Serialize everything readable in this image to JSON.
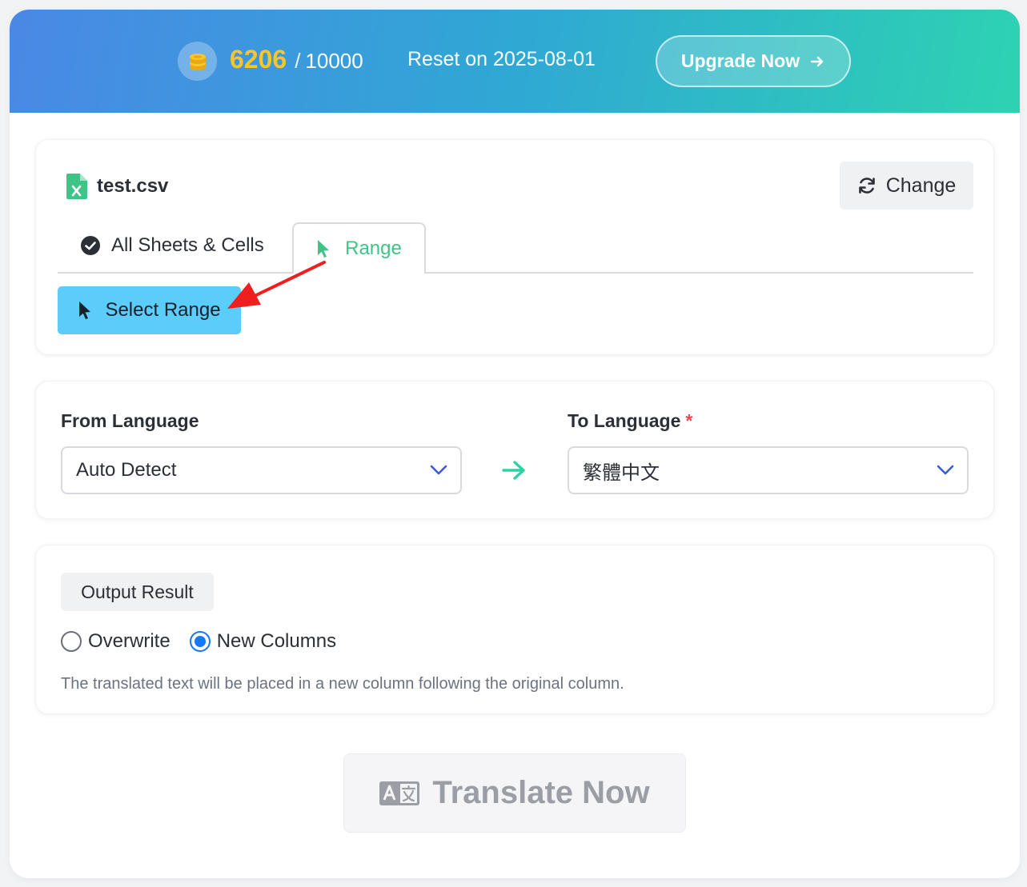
{
  "header": {
    "credits_used": "6206",
    "credits_separator": "/",
    "credits_total": "10000",
    "reset_text": "Reset on 2025-08-01",
    "upgrade_label": "Upgrade Now",
    "coin_icon": "coins-icon",
    "gradient_start": "#4a88e6",
    "gradient_end": "#2ed3b2",
    "credits_color": "#f8c52a"
  },
  "file": {
    "name": "test.csv",
    "icon": "excel-file-icon",
    "change_label": "Change"
  },
  "tabs": [
    {
      "label": "All Sheets & Cells",
      "icon": "check-circle-icon",
      "active": false
    },
    {
      "label": "Range",
      "icon": "cursor-icon",
      "active": true
    }
  ],
  "select_range_label": "Select Range",
  "select_range_color": "#5cccfa",
  "annotation": {
    "type": "red-arrow",
    "color": "#f01e1e",
    "points_to": "Select Range"
  },
  "language": {
    "from_label": "From Language",
    "from_value": "Auto Detect",
    "to_label": "To Language",
    "to_required_mark": "*",
    "to_value": "繁體中文"
  },
  "output": {
    "title": "Output Result",
    "options": [
      {
        "label": "Overwrite",
        "checked": false
      },
      {
        "label": "New Columns",
        "checked": true
      }
    ],
    "description": "The translated text will be placed in a new column following the original column."
  },
  "translate": {
    "label": "Translate Now",
    "icon": "translate-icon",
    "disabled": true
  }
}
